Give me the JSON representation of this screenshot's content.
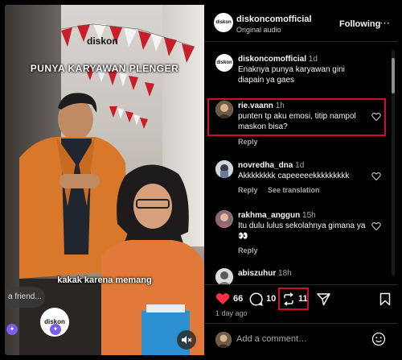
{
  "video": {
    "brand_logo": "diskon",
    "caption_top": "PUNYA KARYAWAN PLENGER",
    "caption_bottom": "kakak karena memang",
    "reply_placeholder": "a friend...",
    "mute_icon": "speaker-muted-icon"
  },
  "header": {
    "username": "diskoncomofficial",
    "audio": "Original audio",
    "follow_label": "Following",
    "more_label": "⋯",
    "avatar_text": "diskon"
  },
  "comments": [
    {
      "user": "diskoncomofficial",
      "time": "1d",
      "text": "Enaknya punya karyawan gini diapain ya gaes",
      "reply": "",
      "translate": ""
    },
    {
      "user": "rie.vaann",
      "time": "1h",
      "text": "punten tp aku emosi, titip nampol maskon bisa?",
      "reply": "Reply",
      "translate": ""
    },
    {
      "user": "novredha_dna",
      "time": "1d",
      "text": "Akkkkkkkk capeeeeekkkkkkkkk",
      "reply": "Reply",
      "translate": "See translation"
    },
    {
      "user": "rakhma_anggun",
      "time": "15h",
      "text": "Itu dulu lulus sekolahnya gimana ya 👀",
      "reply": "Reply",
      "translate": ""
    },
    {
      "user": "abiszuhur",
      "time": "18h",
      "text": "",
      "reply": "",
      "translate": ""
    }
  ],
  "actions": {
    "likes": "66",
    "comments": "10",
    "reposts": "11",
    "date": "1 day ago"
  },
  "add_comment": {
    "placeholder": "Add a comment…"
  },
  "colors": {
    "like_red": "#ff3040",
    "highlight_red": "#c8102e",
    "brand_red": "#d62828",
    "badge_purple": "#7b5cf0"
  }
}
